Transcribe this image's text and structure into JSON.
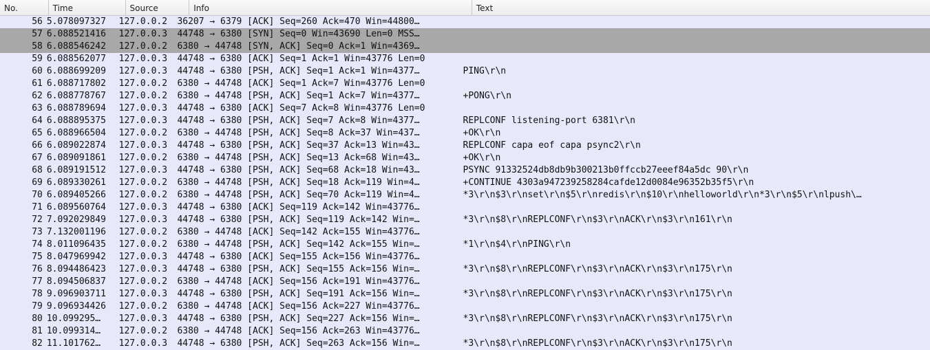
{
  "columns": {
    "no": "No.",
    "time": "Time",
    "src": "Source",
    "info": "Info",
    "text": "Text"
  },
  "rows": [
    {
      "no": "56",
      "time": "5.078097327",
      "src": "127.0.0.2",
      "info": "36207 → 6379 [ACK] Seq=260 Ack=470 Win=44800…",
      "text": "",
      "sel": false
    },
    {
      "no": "57",
      "time": "6.088521416",
      "src": "127.0.0.3",
      "info": "44748 → 6380 [SYN] Seq=0 Win=43690 Len=0 MSS…",
      "text": "",
      "sel": true
    },
    {
      "no": "58",
      "time": "6.088546242",
      "src": "127.0.0.2",
      "info": "6380 → 44748 [SYN, ACK] Seq=0 Ack=1 Win=4369…",
      "text": "",
      "sel": true
    },
    {
      "no": "59",
      "time": "6.088562077",
      "src": "127.0.0.3",
      "info": "44748 → 6380 [ACK] Seq=1 Ack=1 Win=43776 Len=0",
      "text": "",
      "sel": false
    },
    {
      "no": "60",
      "time": "6.088699209",
      "src": "127.0.0.3",
      "info": "44748 → 6380 [PSH, ACK] Seq=1 Ack=1 Win=4377…",
      "text": "PING\\r\\n",
      "sel": false
    },
    {
      "no": "61",
      "time": "6.088717802",
      "src": "127.0.0.2",
      "info": "6380 → 44748 [ACK] Seq=1 Ack=7 Win=43776 Len=0",
      "text": "",
      "sel": false
    },
    {
      "no": "62",
      "time": "6.088778767",
      "src": "127.0.0.2",
      "info": "6380 → 44748 [PSH, ACK] Seq=1 Ack=7 Win=4377…",
      "text": "+PONG\\r\\n",
      "sel": false
    },
    {
      "no": "63",
      "time": "6.088789694",
      "src": "127.0.0.3",
      "info": "44748 → 6380 [ACK] Seq=7 Ack=8 Win=43776 Len=0",
      "text": "",
      "sel": false
    },
    {
      "no": "64",
      "time": "6.088895375",
      "src": "127.0.0.3",
      "info": "44748 → 6380 [PSH, ACK] Seq=7 Ack=8 Win=4377…",
      "text": "REPLCONF listening-port 6381\\r\\n",
      "sel": false
    },
    {
      "no": "65",
      "time": "6.088966504",
      "src": "127.0.0.2",
      "info": "6380 → 44748 [PSH, ACK] Seq=8 Ack=37 Win=437…",
      "text": "+OK\\r\\n",
      "sel": false
    },
    {
      "no": "66",
      "time": "6.089022874",
      "src": "127.0.0.3",
      "info": "44748 → 6380 [PSH, ACK] Seq=37 Ack=13 Win=43…",
      "text": "REPLCONF capa eof capa psync2\\r\\n",
      "sel": false
    },
    {
      "no": "67",
      "time": "6.089091861",
      "src": "127.0.0.2",
      "info": "6380 → 44748 [PSH, ACK] Seq=13 Ack=68 Win=43…",
      "text": "+OK\\r\\n",
      "sel": false
    },
    {
      "no": "68",
      "time": "6.089191512",
      "src": "127.0.0.3",
      "info": "44748 → 6380 [PSH, ACK] Seq=68 Ack=18 Win=43…",
      "text": "PSYNC 91332524db8db9b300213b0ffccb27eeef84a5dc 90\\r\\n",
      "sel": false
    },
    {
      "no": "69",
      "time": "6.089330261",
      "src": "127.0.0.2",
      "info": "6380 → 44748 [PSH, ACK] Seq=18 Ack=119 Win=4…",
      "text": "+CONTINUE 4303a947239258284cafde12d0084e96352b35f5\\r\\n",
      "sel": false
    },
    {
      "no": "70",
      "time": "6.089405266",
      "src": "127.0.0.2",
      "info": "6380 → 44748 [PSH, ACK] Seq=70 Ack=119 Win=4…",
      "text": "*3\\r\\n$3\\r\\nset\\r\\n$5\\r\\nredis\\r\\n$10\\r\\nhelloworld\\r\\n*3\\r\\n$5\\r\\nlpush\\…",
      "sel": false
    },
    {
      "no": "71",
      "time": "6.089560764",
      "src": "127.0.0.3",
      "info": "44748 → 6380 [ACK] Seq=119 Ack=142 Win=43776…",
      "text": "",
      "sel": false
    },
    {
      "no": "72",
      "time": "7.092029849",
      "src": "127.0.0.3",
      "info": "44748 → 6380 [PSH, ACK] Seq=119 Ack=142 Win=…",
      "text": "*3\\r\\n$8\\r\\nREPLCONF\\r\\n$3\\r\\nACK\\r\\n$3\\r\\n161\\r\\n",
      "sel": false
    },
    {
      "no": "73",
      "time": "7.132001196",
      "src": "127.0.0.2",
      "info": "6380 → 44748 [ACK] Seq=142 Ack=155 Win=43776…",
      "text": "",
      "sel": false
    },
    {
      "no": "74",
      "time": "8.011096435",
      "src": "127.0.0.2",
      "info": "6380 → 44748 [PSH, ACK] Seq=142 Ack=155 Win=…",
      "text": "*1\\r\\n$4\\r\\nPING\\r\\n",
      "sel": false
    },
    {
      "no": "75",
      "time": "8.047969942",
      "src": "127.0.0.3",
      "info": "44748 → 6380 [ACK] Seq=155 Ack=156 Win=43776…",
      "text": "",
      "sel": false
    },
    {
      "no": "76",
      "time": "8.094486423",
      "src": "127.0.0.3",
      "info": "44748 → 6380 [PSH, ACK] Seq=155 Ack=156 Win=…",
      "text": "*3\\r\\n$8\\r\\nREPLCONF\\r\\n$3\\r\\nACK\\r\\n$3\\r\\n175\\r\\n",
      "sel": false
    },
    {
      "no": "77",
      "time": "8.094506837",
      "src": "127.0.0.2",
      "info": "6380 → 44748 [ACK] Seq=156 Ack=191 Win=43776…",
      "text": "",
      "sel": false
    },
    {
      "no": "78",
      "time": "9.096903711",
      "src": "127.0.0.3",
      "info": "44748 → 6380 [PSH, ACK] Seq=191 Ack=156 Win=…",
      "text": "*3\\r\\n$8\\r\\nREPLCONF\\r\\n$3\\r\\nACK\\r\\n$3\\r\\n175\\r\\n",
      "sel": false
    },
    {
      "no": "79",
      "time": "9.096934426",
      "src": "127.0.0.2",
      "info": "6380 → 44748 [ACK] Seq=156 Ack=227 Win=43776…",
      "text": "",
      "sel": false
    },
    {
      "no": "80",
      "time": "10.099295…",
      "src": "127.0.0.3",
      "info": "44748 → 6380 [PSH, ACK] Seq=227 Ack=156 Win=…",
      "text": "*3\\r\\n$8\\r\\nREPLCONF\\r\\n$3\\r\\nACK\\r\\n$3\\r\\n175\\r\\n",
      "sel": false
    },
    {
      "no": "81",
      "time": "10.099314…",
      "src": "127.0.0.2",
      "info": "6380 → 44748 [ACK] Seq=156 Ack=263 Win=43776…",
      "text": "",
      "sel": false
    },
    {
      "no": "82",
      "time": "11.101762…",
      "src": "127.0.0.3",
      "info": "44748 → 6380 [PSH, ACK] Seq=263 Ack=156 Win=…",
      "text": "*3\\r\\n$8\\r\\nREPLCONF\\r\\n$3\\r\\nACK\\r\\n$3\\r\\n175\\r\\n",
      "sel": false
    }
  ]
}
